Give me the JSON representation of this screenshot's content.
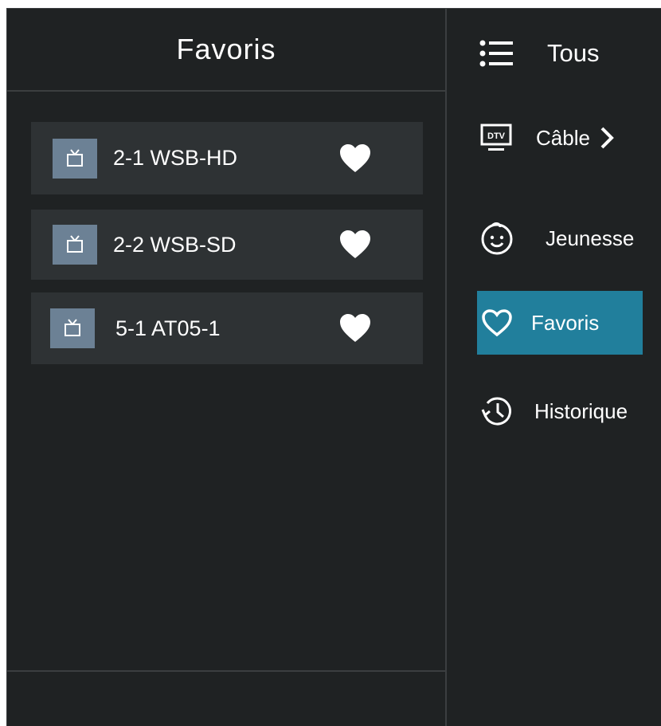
{
  "header": {
    "title": "Favoris"
  },
  "channels": [
    {
      "name": "2-1 WSB-HD",
      "icon": "tv-icon",
      "favorite": true
    },
    {
      "name": "2-2 WSB-SD",
      "icon": "tv-icon",
      "favorite": true
    },
    {
      "name": "5-1 AT05-1",
      "icon": "tv-icon",
      "favorite": true
    }
  ],
  "menu": {
    "items": [
      {
        "label": "Tous",
        "icon": "list-icon"
      },
      {
        "label": "Câble",
        "icon": "dtv-icon",
        "badge": "DTV"
      },
      {
        "label": "Jeunesse",
        "icon": "child-face-icon"
      },
      {
        "label": "Favoris",
        "icon": "heart-outline-icon",
        "selected": true
      },
      {
        "label": "Historique",
        "icon": "history-icon"
      }
    ]
  },
  "colors": {
    "background": "#1f2223",
    "row": "#2e3234",
    "channel_icon_bg": "#6c8195",
    "accent": "#217f9c",
    "text": "#ffffff",
    "divider": "#3b3e40"
  }
}
